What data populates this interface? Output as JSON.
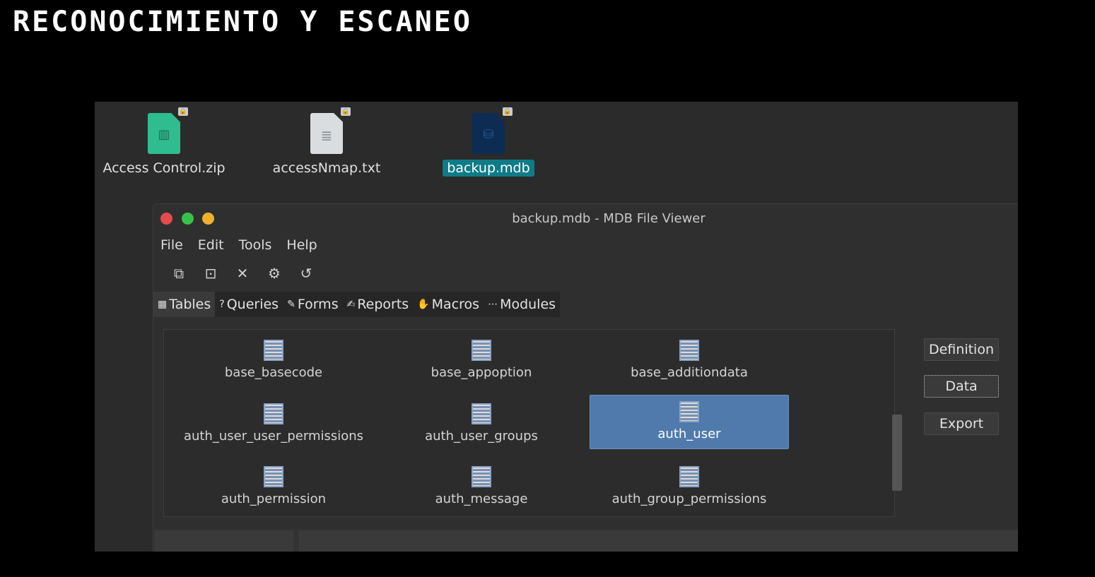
{
  "slide": {
    "title": "RECONOCIMIENTO Y ESCANEO"
  },
  "desktop": {
    "files": [
      {
        "name": "Access Control.zip"
      },
      {
        "name": "accessNmap.txt"
      },
      {
        "name": "backup.mdb"
      }
    ]
  },
  "window": {
    "title": "backup.mdb - MDB File Viewer",
    "menu": [
      "File",
      "Edit",
      "Tools",
      "Help"
    ],
    "toolbar_icons": [
      "copy-icon",
      "preview-icon",
      "close-icon",
      "settings-icon",
      "undo-icon"
    ],
    "tabs": [
      "Tables",
      "Queries",
      "Forms",
      "Reports",
      "Macros",
      "Modules"
    ],
    "tables": [
      "base_basecode",
      "base_appoption",
      "base_additiondata",
      "auth_user_user_permissions",
      "auth_user_groups",
      "auth_user",
      "auth_permission",
      "auth_message",
      "auth_group_permissions"
    ],
    "selected_table": "auth_user",
    "buttons": {
      "definition": "Definition",
      "data": "Data",
      "export": "Export"
    }
  }
}
